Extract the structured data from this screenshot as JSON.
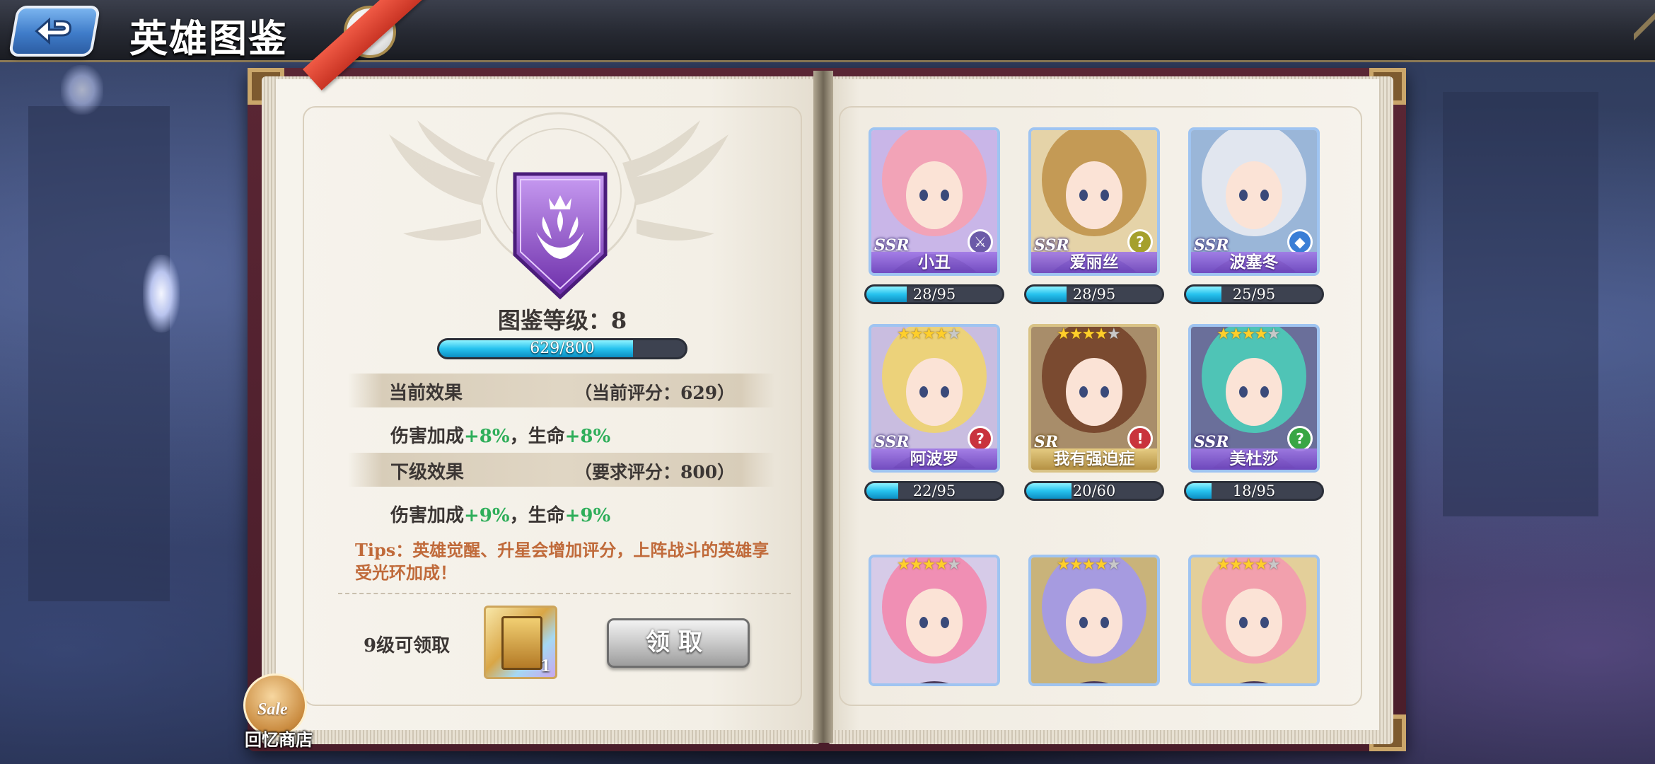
{
  "header": {
    "title": "英雄图鉴",
    "help_label": "?"
  },
  "codex": {
    "level_text": "图鉴等级：8",
    "progress_text": "629/800",
    "progress_fraction": 0.786,
    "current_effect": {
      "title": "当前效果",
      "score": "（当前评分：629）",
      "damage_label": "伤害加成",
      "damage_value": "+8%",
      "separator": "，",
      "hp_label": "生命",
      "hp_value": "+8%"
    },
    "next_effect": {
      "title": "下级效果",
      "score": "（要求评分：800）",
      "damage_label": "伤害加成",
      "damage_value": "+9%",
      "separator": "，",
      "hp_label": "生命",
      "hp_value": "+9%"
    },
    "tips": "Tips：英雄觉醒、升星会增加评分，上阵战斗的英雄享受光环加成！",
    "reward_label": "9级可领取",
    "reward_count": "1",
    "claim_label": "领取"
  },
  "heroes": [
    {
      "name": "小丑",
      "rarity": "SSR",
      "stars": 0,
      "shards": "28/95",
      "fraction": 0.295,
      "class_icon": "⚔",
      "class_color": "#6b5aa8",
      "hair": "#f2a3b7",
      "bg": "#c9b6e8"
    },
    {
      "name": "爱丽丝",
      "rarity": "SSR",
      "stars": 0,
      "shards": "28/95",
      "fraction": 0.295,
      "class_icon": "?",
      "class_color": "#a5a02c",
      "hair": "#c49a55",
      "bg": "#e5d3a8"
    },
    {
      "name": "波塞冬",
      "rarity": "SSR",
      "stars": 0,
      "shards": "25/95",
      "fraction": 0.263,
      "class_icon": "◆",
      "class_color": "#3a7ed6",
      "hair": "#e1e6ef",
      "bg": "#9ab6d8"
    },
    {
      "name": "阿波罗",
      "rarity": "SSR",
      "stars": 4,
      "shards": "22/95",
      "fraction": 0.232,
      "class_icon": "?",
      "class_color": "#c9333d",
      "hair": "#ecd27a",
      "bg": "#c9bde0"
    },
    {
      "name": "我有强迫症",
      "rarity": "SR",
      "stars": 4,
      "shards": "20/60",
      "fraction": 0.333,
      "class_icon": "!",
      "class_color": "#c9333d",
      "hair": "#7a4a30",
      "bg": "#a88d6a"
    },
    {
      "name": "美杜莎",
      "rarity": "SSR",
      "stars": 4,
      "shards": "18/95",
      "fraction": 0.189,
      "class_icon": "?",
      "class_color": "#39a645",
      "hair": "#4fc4b6",
      "bg": "#6a6f9a"
    },
    {
      "name": "",
      "rarity": "",
      "stars": 4,
      "shards": "",
      "fraction": 0,
      "class_icon": "",
      "class_color": "#3a7ed6",
      "hair": "#f08fb4",
      "bg": "#d6cbe8"
    },
    {
      "name": "",
      "rarity": "",
      "stars": 4,
      "shards": "",
      "fraction": 0,
      "class_icon": "",
      "class_color": "#c9333d",
      "hair": "#a69be0",
      "bg": "#c9b37a"
    },
    {
      "name": "",
      "rarity": "",
      "stars": 4,
      "shards": "",
      "fraction": 0,
      "class_icon": "",
      "class_color": "#3a7ed6",
      "hair": "#f2a0ad",
      "bg": "#e3cf9a"
    }
  ],
  "shop": {
    "badge": "Sale",
    "label": "回忆商店"
  }
}
